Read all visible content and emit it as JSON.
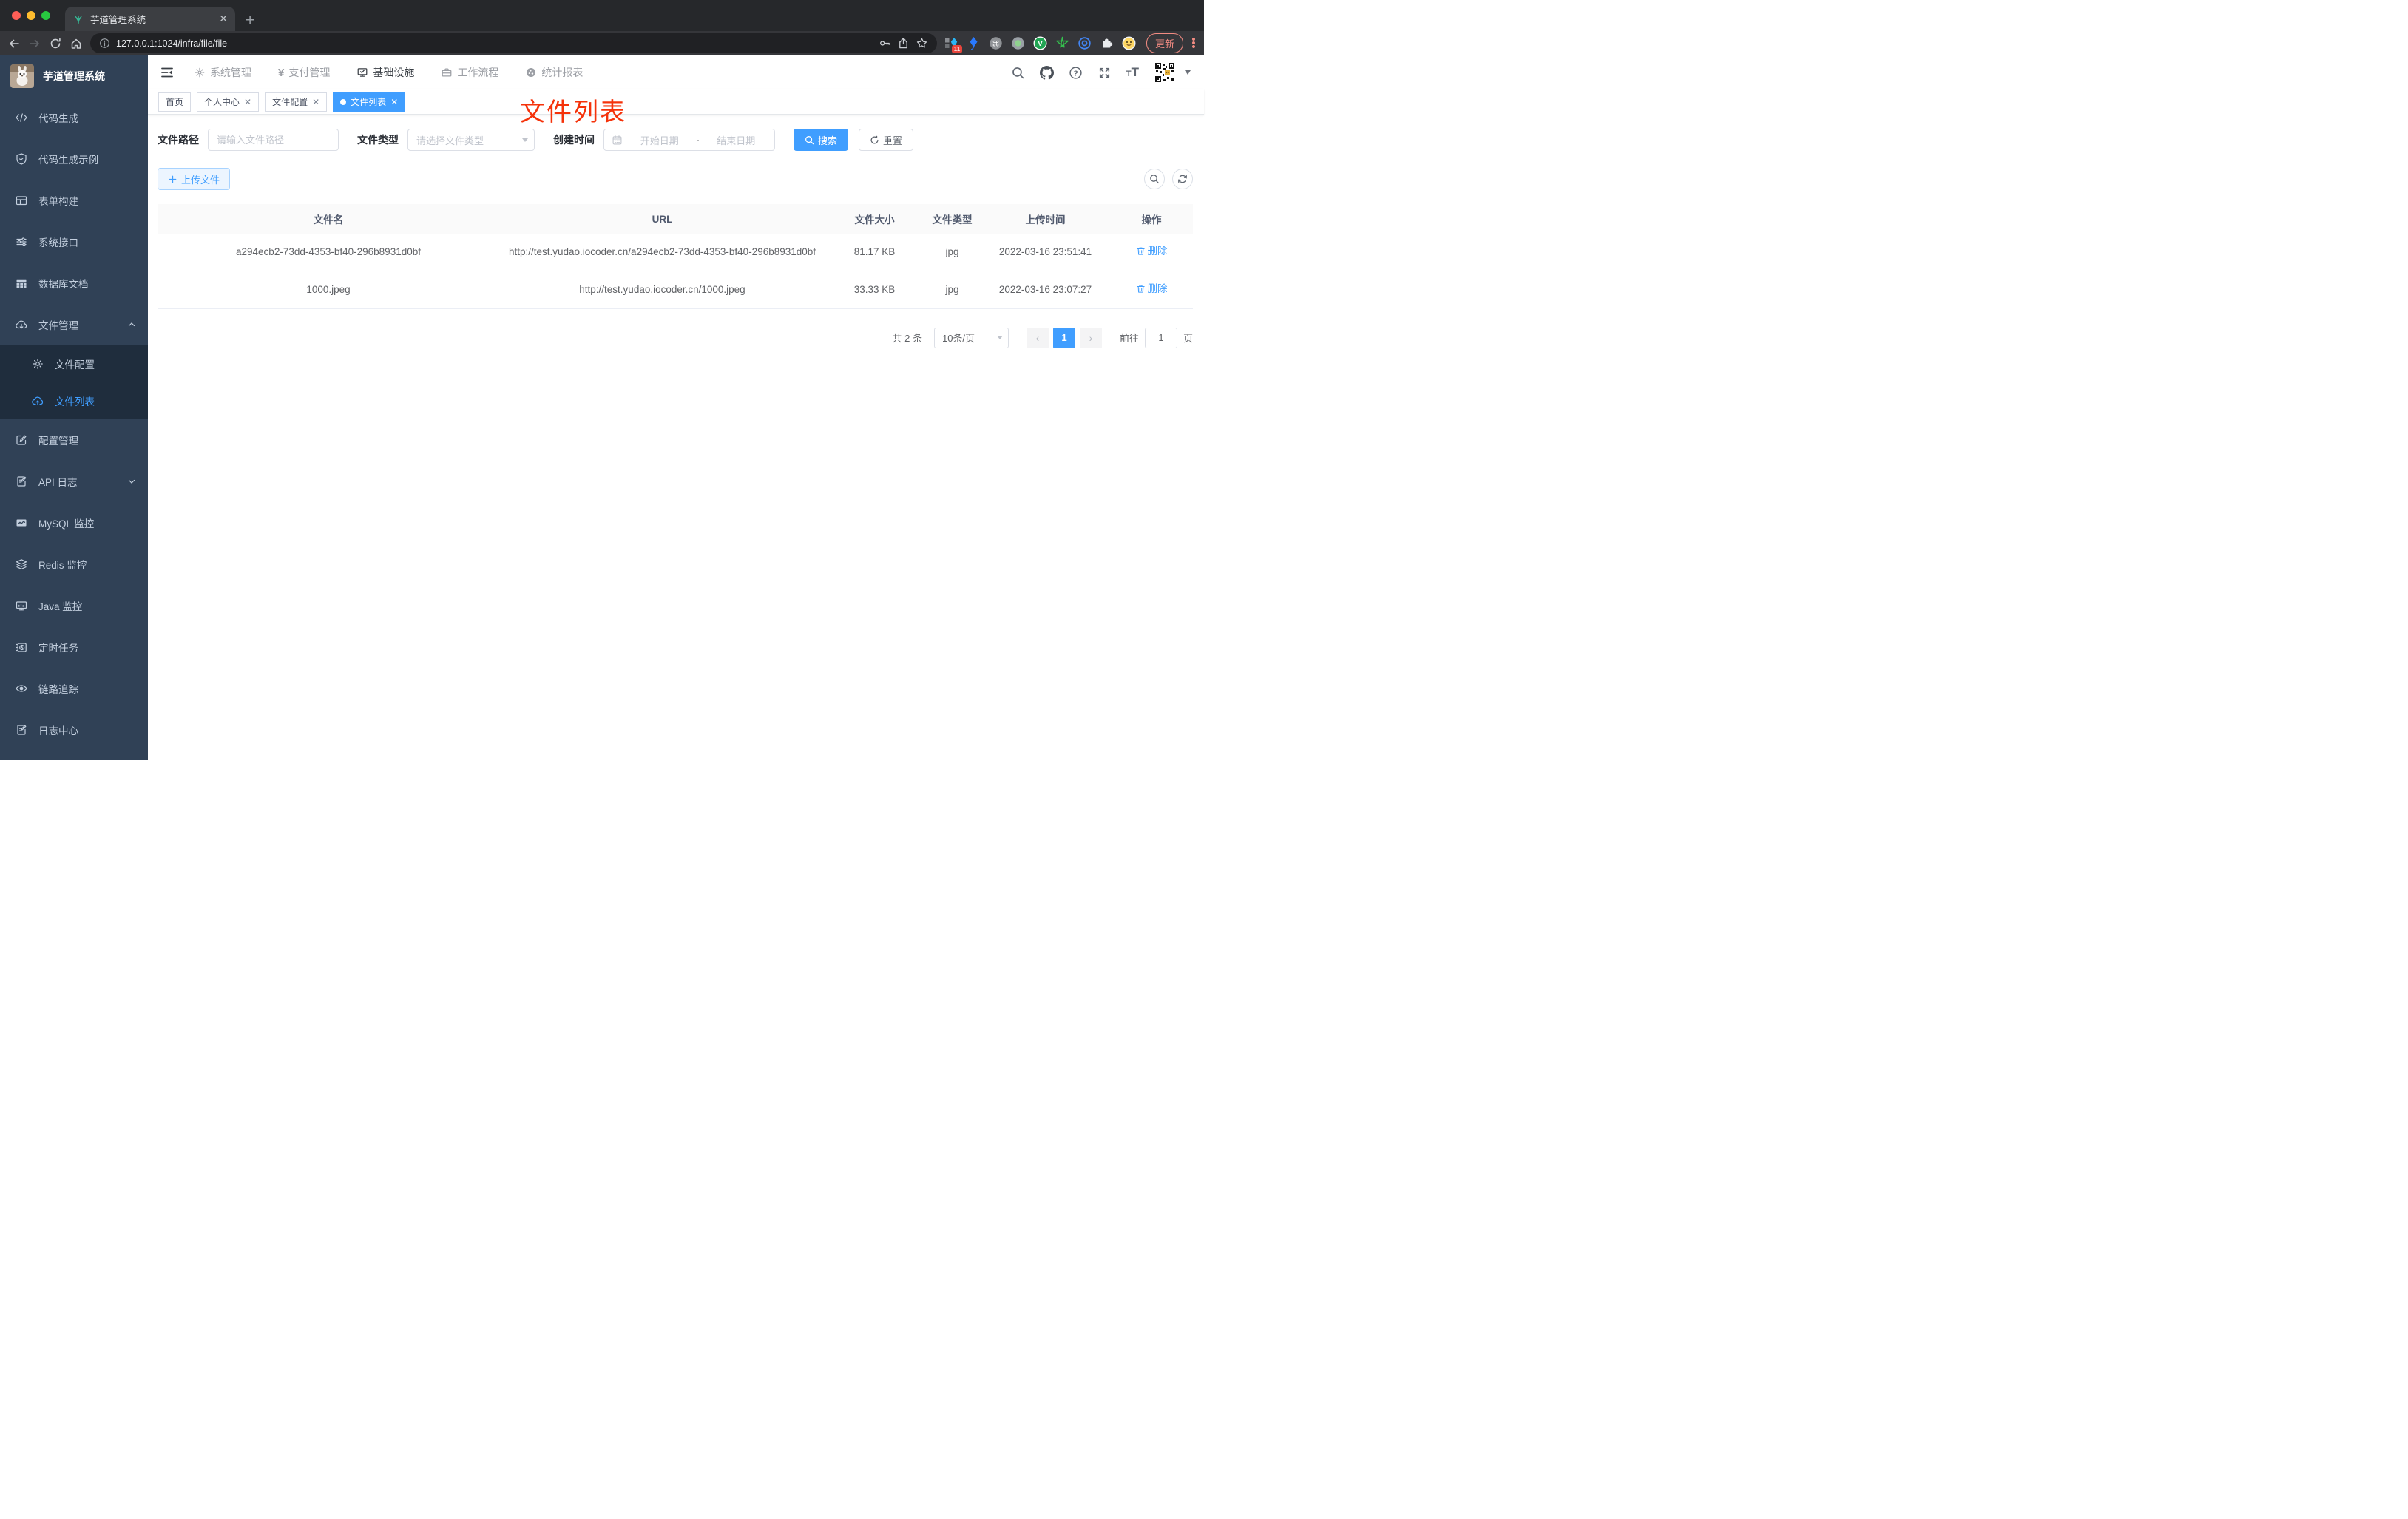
{
  "browser": {
    "tab_title": "芋道管理系统",
    "url": "127.0.0.1:1024/infra/file/file",
    "extension_badge": "11",
    "update_label": "更新"
  },
  "app_header": {
    "nav": [
      {
        "label": "系统管理",
        "active": false
      },
      {
        "label": "支付管理",
        "active": false
      },
      {
        "label": "基础设施",
        "active": true
      },
      {
        "label": "工作流程",
        "active": false
      },
      {
        "label": "统计报表",
        "active": false
      }
    ]
  },
  "tags": [
    {
      "label": "首页",
      "closable": false,
      "active": false
    },
    {
      "label": "个人中心",
      "closable": true,
      "active": false
    },
    {
      "label": "文件配置",
      "closable": true,
      "active": false
    },
    {
      "label": "文件列表",
      "closable": true,
      "active": true
    }
  ],
  "annotation": {
    "text": "文件列表",
    "color": "#f5320a"
  },
  "sidebar": {
    "title": "芋道管理系统",
    "items": [
      {
        "label": "代码生成"
      },
      {
        "label": "代码生成示例"
      },
      {
        "label": "表单构建"
      },
      {
        "label": "系统接口"
      },
      {
        "label": "数据库文档"
      },
      {
        "label": "文件管理",
        "expanded": true,
        "children": [
          {
            "label": "文件配置",
            "active": false
          },
          {
            "label": "文件列表",
            "active": true
          }
        ]
      },
      {
        "label": "配置管理"
      },
      {
        "label": "API 日志",
        "has_children": true
      },
      {
        "label": "MySQL 监控"
      },
      {
        "label": "Redis 监控"
      },
      {
        "label": "Java 监控"
      },
      {
        "label": "定时任务"
      },
      {
        "label": "链路追踪"
      },
      {
        "label": "日志中心"
      }
    ]
  },
  "filters": {
    "path_label": "文件路径",
    "path_placeholder": "请输入文件路径",
    "type_label": "文件类型",
    "type_placeholder": "请选择文件类型",
    "date_label": "创建时间",
    "date_start_placeholder": "开始日期",
    "date_separator": "-",
    "date_end_placeholder": "结束日期",
    "search_label": "搜索",
    "reset_label": "重置"
  },
  "toolbar": {
    "upload_label": "上传文件"
  },
  "table": {
    "columns": [
      "文件名",
      "URL",
      "文件大小",
      "文件类型",
      "上传时间",
      "操作"
    ],
    "rows": [
      {
        "name": "a294ecb2-73dd-4353-bf40-296b8931d0bf",
        "url": "http://test.yudao.iocoder.cn/a294ecb2-73dd-4353-bf40-296b8931d0bf",
        "size": "81.17 KB",
        "type": "jpg",
        "time": "2022-03-16 23:51:41",
        "action": "删除"
      },
      {
        "name": "1000.jpeg",
        "url": "http://test.yudao.iocoder.cn/1000.jpeg",
        "size": "33.33 KB",
        "type": "jpg",
        "time": "2022-03-16 23:07:27",
        "action": "删除"
      }
    ]
  },
  "pagination": {
    "total": "共 2 条",
    "page_size": "10条/页",
    "current_page": "1",
    "goto_label": "前往",
    "goto_value": "1",
    "goto_suffix": "页"
  },
  "colors": {
    "accent": "#409eff",
    "annotation_red": "#f5320a",
    "sidebar_bg": "#304156"
  }
}
